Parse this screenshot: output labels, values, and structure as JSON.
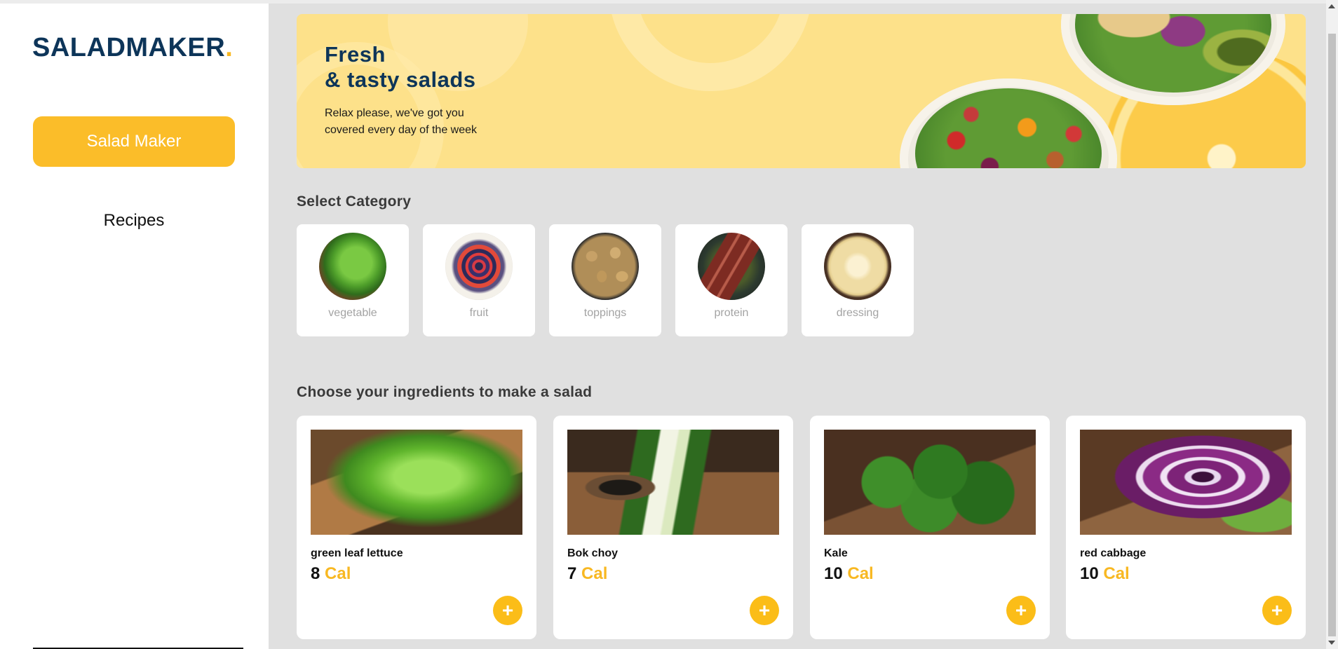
{
  "brand": {
    "name": "SALADMAKER",
    "dot": "."
  },
  "sidebar": {
    "primary_button": "Salad Maker",
    "nav_link": "Recipes"
  },
  "banner": {
    "title_line1": "Fresh",
    "title_line2": "& tasty salads",
    "subtitle": "Relax please, we've got you covered every day of the week"
  },
  "categories": {
    "title": "Select Category",
    "items": [
      {
        "label": "vegetable",
        "icon": "lettuce-photo"
      },
      {
        "label": "fruit",
        "icon": "berries-bowl-photo"
      },
      {
        "label": "toppings",
        "icon": "cashews-photo"
      },
      {
        "label": "protein",
        "icon": "steak-photo"
      },
      {
        "label": "dressing",
        "icon": "dressing-photo"
      }
    ]
  },
  "ingredients": {
    "title": "Choose your ingredients to make a salad",
    "unit": "Cal",
    "add_icon": "+",
    "items": [
      {
        "name": "green leaf lettuce",
        "calories": "8"
      },
      {
        "name": "Bok choy",
        "calories": "7"
      },
      {
        "name": "Kale",
        "calories": "10"
      },
      {
        "name": "red cabbage",
        "calories": "10"
      }
    ]
  },
  "colors": {
    "accent": "#fbbd29",
    "brand_navy": "#0d3559",
    "banner_bg": "#fde18a",
    "page_bg": "#e0e0e0"
  }
}
